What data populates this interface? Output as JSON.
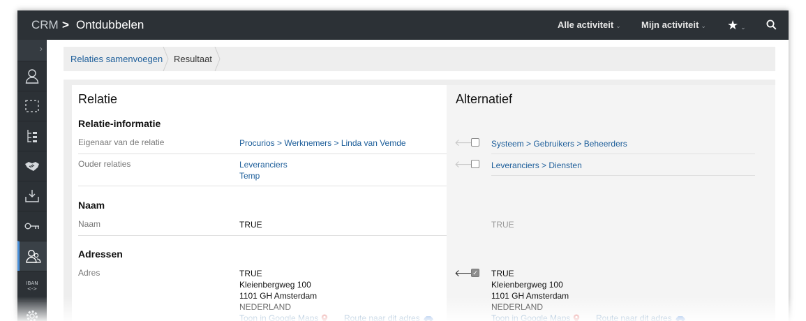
{
  "topbar": {
    "app": "CRM",
    "separator": ">",
    "page_title": "Ontdubbelen",
    "nav": [
      {
        "label": "Alle activiteit",
        "caret": "⌄"
      },
      {
        "label": "Mijn activiteit",
        "caret": "⌄"
      }
    ],
    "favorites_caret": "⌄"
  },
  "sidebar": {
    "toggle": "›",
    "items": [
      {
        "icon": "user-icon"
      },
      {
        "icon": "selection-icon"
      },
      {
        "icon": "hierarchy-icon"
      },
      {
        "icon": "handshake-icon"
      },
      {
        "icon": "download-tray-icon"
      },
      {
        "icon": "key-icon"
      },
      {
        "icon": "merge-users-icon",
        "active": true
      },
      {
        "icon": "iban-icon",
        "text_top": "IBAN",
        "text_bottom": "<->"
      },
      {
        "icon": "gear-icon"
      }
    ]
  },
  "breadcrumb": {
    "items": [
      "Relaties samenvoegen",
      "Resultaat"
    ]
  },
  "left": {
    "title": "Relatie",
    "sections": {
      "info": {
        "title": "Relatie-informatie",
        "owner_label": "Eigenaar van de relatie",
        "owner_value": "Procurios > Werknemers > Linda van Vemde",
        "parent_label": "Ouder relaties",
        "parent_values": [
          "Leveranciers",
          "Temp"
        ]
      },
      "name": {
        "title": "Naam",
        "label": "Naam",
        "value": "TRUE"
      },
      "address": {
        "title": "Adressen",
        "label": "Adres",
        "lines": [
          "TRUE",
          "Kleienbergweg 100",
          "1101 GH Amsterdam",
          "NEDERLAND"
        ],
        "maps_link": "Toon in Google Maps",
        "route_link": "Route naar dit adres"
      }
    }
  },
  "right": {
    "title": "Alternatief",
    "owner_value": "Systeem > Gebruikers > Beheerders",
    "parent_value": "Leveranciers > Diensten",
    "name_value": "TRUE",
    "address_lines": [
      "TRUE",
      "Kleienbergweg 100",
      "1101 GH Amsterdam",
      "NEDERLAND"
    ],
    "maps_link": "Toon in Google Maps",
    "route_link": "Route naar dit adres",
    "arrow": "🡐"
  },
  "colors": {
    "topbar": "#2c3136",
    "link": "#1d5e9a",
    "active_accent": "#4a90d9"
  }
}
